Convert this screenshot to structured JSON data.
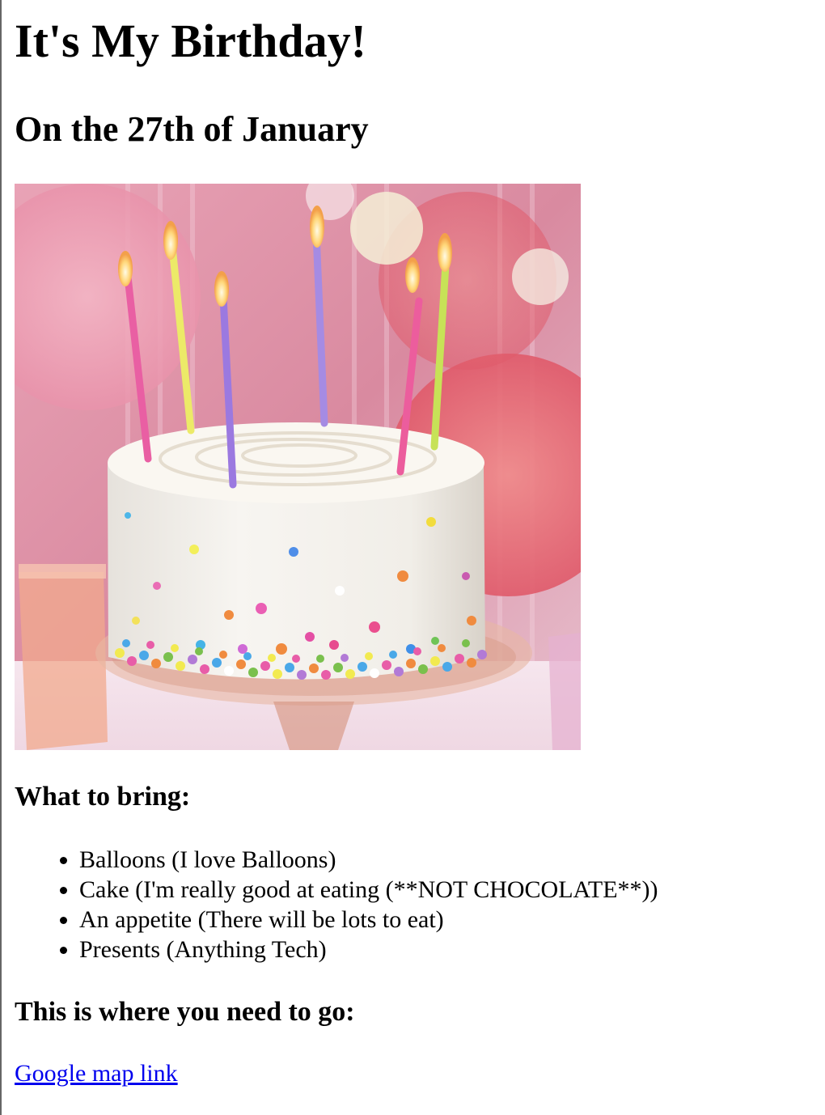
{
  "header": {
    "title": "It's My Birthday!",
    "subtitle": "On the 27th of January"
  },
  "image": {
    "alt": "Birthday cake with candles"
  },
  "bring": {
    "heading": "What to bring:",
    "items": [
      "Balloons (I love Balloons)",
      "Cake (I'm really good at eating (**NOT CHOCOLATE**))",
      "An appetite (There will be lots to eat)",
      "Presents (Anything Tech)"
    ]
  },
  "location": {
    "heading": "This is where you need to go:",
    "link_text": "Google map link"
  },
  "colors": {
    "link": "#0000ee",
    "text": "#000000",
    "background": "#ffffff"
  }
}
